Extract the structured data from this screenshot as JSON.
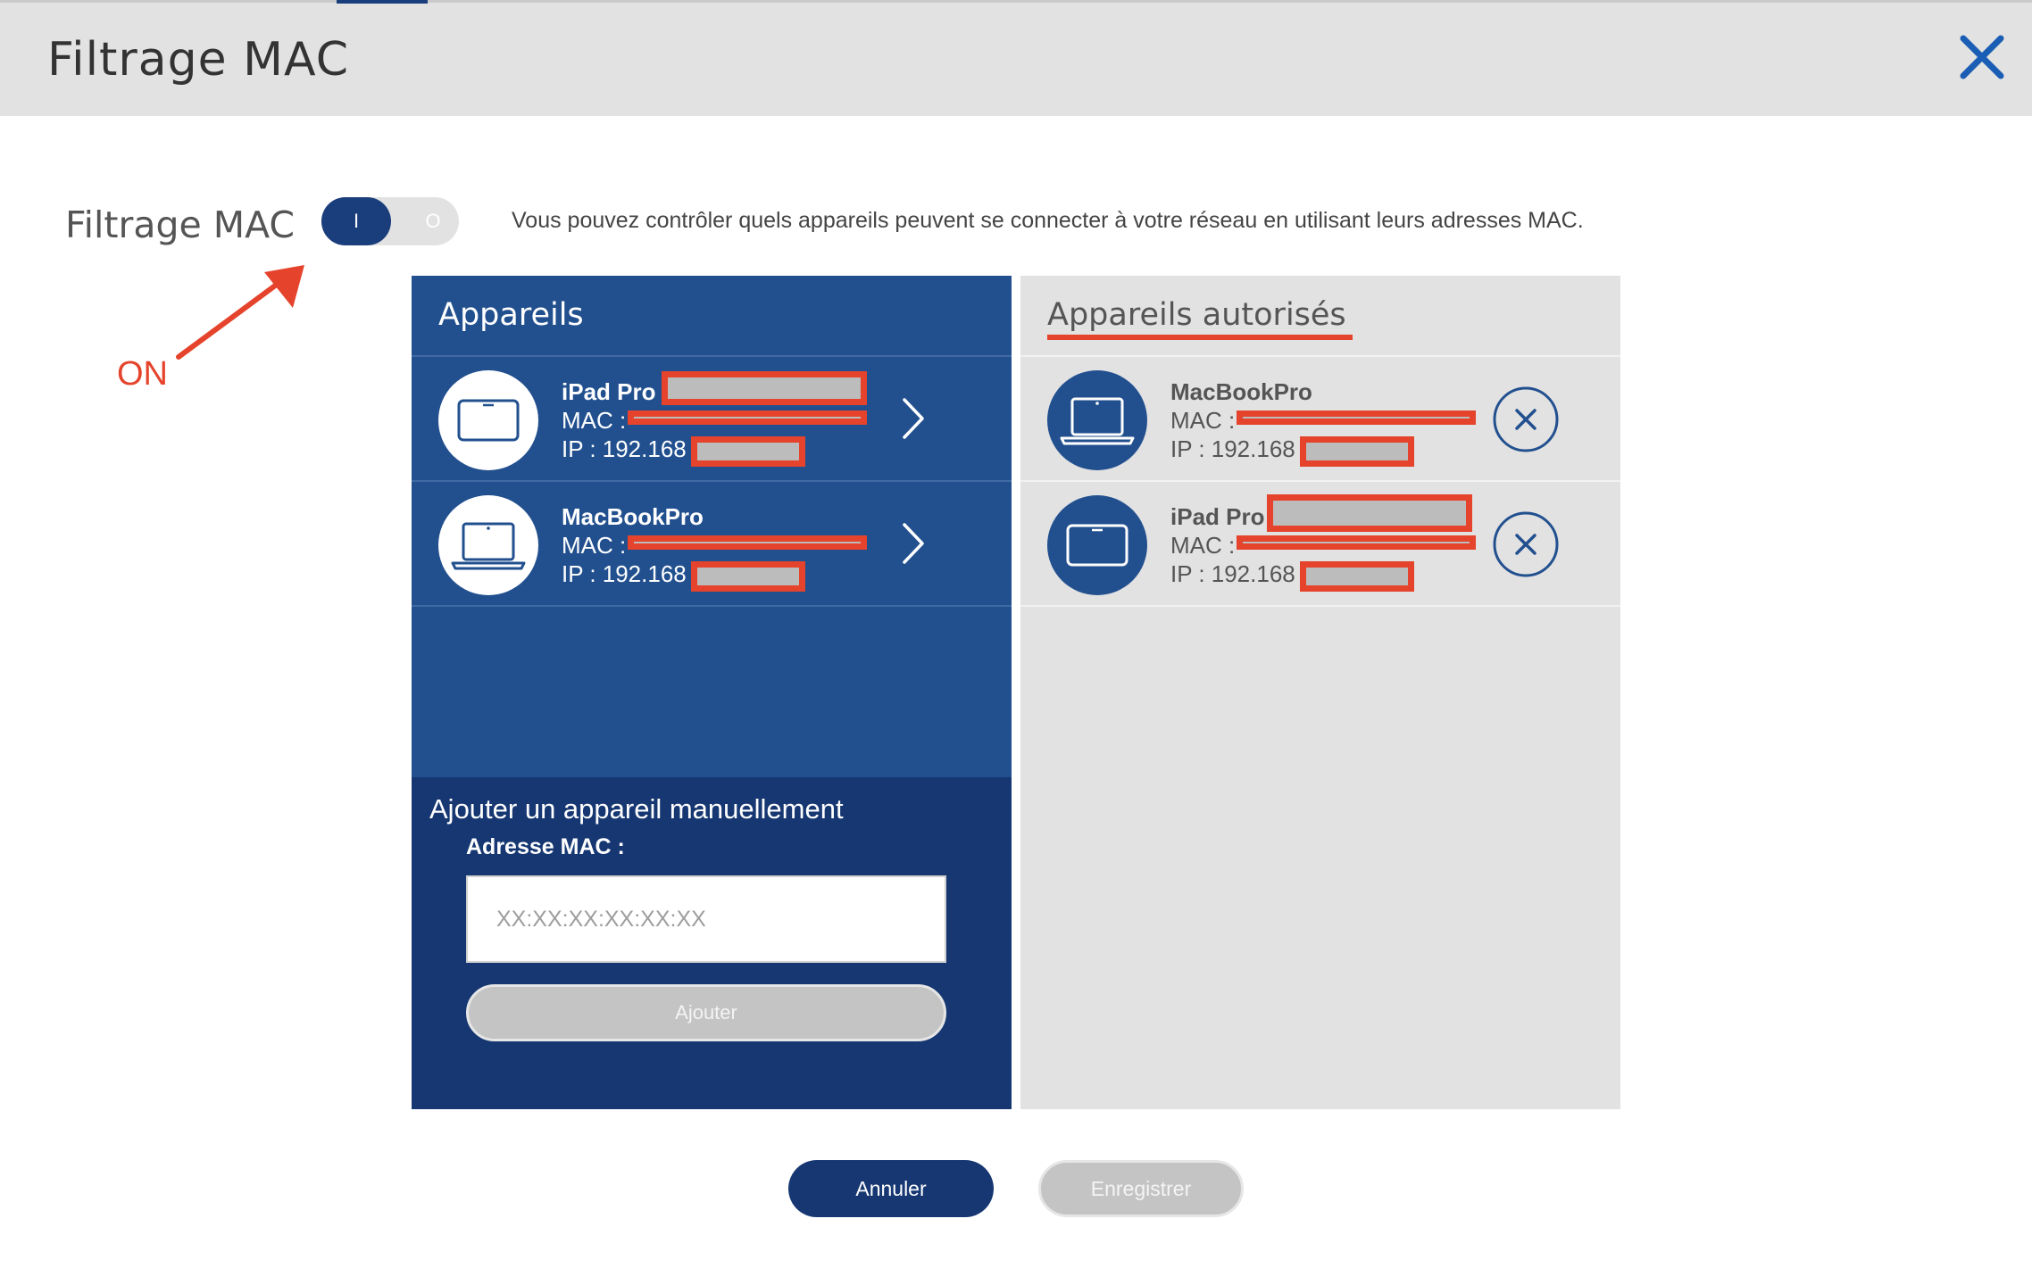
{
  "header": {
    "title": "Filtrage MAC",
    "close_icon": "close-icon",
    "accent_color": "#1a3e7b"
  },
  "toggle": {
    "label": "Filtrage MAC",
    "on_text": "I",
    "off_text": "O",
    "state": "on"
  },
  "description": "Vous pouvez contrôler quels appareils peuvent se connecter à votre réseau en utilisant leurs adresses MAC.",
  "annotation": {
    "text": "ON",
    "color": "#e5432b"
  },
  "devices_panel": {
    "title": "Appareils",
    "items": [
      {
        "name": "iPad Pro",
        "mac": "MAC :",
        "ip": "IP : 192.168",
        "icon": "tablet-icon"
      },
      {
        "name": "MacBookPro",
        "mac": "MAC :",
        "ip": "IP : 192.168",
        "icon": "laptop-icon"
      }
    ]
  },
  "authorized_panel": {
    "title": "Appareils autorisés",
    "items": [
      {
        "name": "MacBookPro",
        "mac": "MAC :",
        "ip": "IP : 192.168",
        "icon": "laptop-icon"
      },
      {
        "name": "iPad Pro",
        "mac": "MAC :",
        "ip": "IP : 192.168",
        "icon": "tablet-icon"
      }
    ]
  },
  "manual_add": {
    "title": "Ajouter un appareil manuellement",
    "mac_label": "Adresse MAC :",
    "mac_placeholder": "XX:XX:XX:XX:XX:XX",
    "add_button": "Ajouter"
  },
  "footer": {
    "cancel": "Annuler",
    "save": "Enregistrer"
  },
  "colors": {
    "primary": "#22508f",
    "dark": "#163772",
    "disabled": "#c4c4c4",
    "redaction": "#e5432b"
  }
}
